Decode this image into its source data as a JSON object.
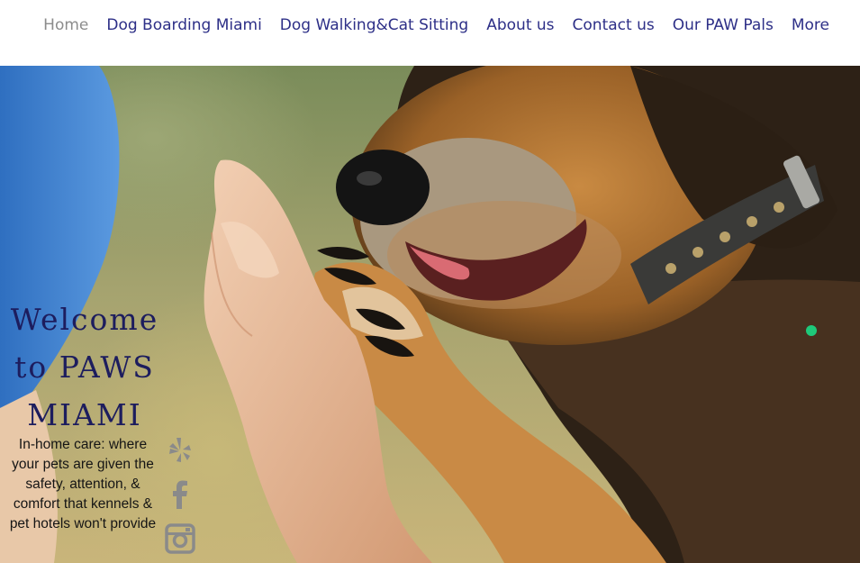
{
  "nav": {
    "items": [
      {
        "label": "Home",
        "active": true
      },
      {
        "label": "Dog Boarding Miami",
        "active": false
      },
      {
        "label": "Dog Walking&Cat Sitting",
        "active": false
      },
      {
        "label": "About us",
        "active": false
      },
      {
        "label": "Contact us",
        "active": false
      },
      {
        "label": "Our PAW Pals",
        "active": false
      },
      {
        "label": "More",
        "active": false
      }
    ]
  },
  "hero": {
    "headline_lines": [
      "Welcome",
      "to PAWS",
      "MIAMI"
    ],
    "subtext_lines": [
      "In-home care: where",
      "your pets are given the",
      "safety, attention, &",
      "comfort that kennels &",
      "pet hotels won't provide"
    ],
    "social_icons": [
      "yelp-icon",
      "facebook-icon",
      "instagram-icon"
    ]
  },
  "colors": {
    "nav_link": "#2d2f87",
    "nav_active": "#8c8c8c",
    "headline": "#1d1d5e",
    "social_icon": "#8a8a8a",
    "dot": "#1ec97a"
  }
}
